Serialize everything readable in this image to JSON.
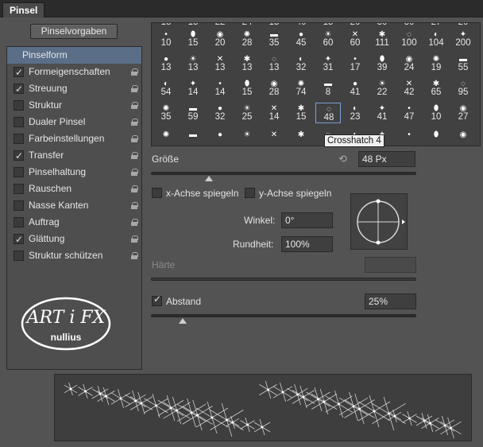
{
  "panel": {
    "tab_label": "Pinsel",
    "preset_button": "Pinselvorgaben"
  },
  "sidebar": {
    "items": [
      {
        "label": "Pinselform",
        "checkbox": false,
        "checked": false,
        "selected": true,
        "lock": false
      },
      {
        "label": "Formeigenschaften",
        "checkbox": true,
        "checked": true,
        "lock": true
      },
      {
        "label": "Streuung",
        "checkbox": true,
        "checked": true,
        "lock": true
      },
      {
        "label": "Struktur",
        "checkbox": true,
        "checked": false,
        "lock": true
      },
      {
        "label": "Dualer Pinsel",
        "checkbox": true,
        "checked": false,
        "lock": true
      },
      {
        "label": "Farbeinstellungen",
        "checkbox": true,
        "checked": false,
        "lock": true
      },
      {
        "label": "Transfer",
        "checkbox": true,
        "checked": true,
        "lock": true
      },
      {
        "label": "Pinselhaltung",
        "checkbox": true,
        "checked": false,
        "lock": true
      },
      {
        "label": "Rauschen",
        "checkbox": true,
        "checked": false,
        "lock": true
      },
      {
        "label": "Nasse Kanten",
        "checkbox": true,
        "checked": false,
        "lock": true
      },
      {
        "label": "Auftrag",
        "checkbox": true,
        "checked": false,
        "lock": true
      },
      {
        "label": "Glättung",
        "checkbox": true,
        "checked": true,
        "lock": true
      },
      {
        "label": "Struktur schützen",
        "checkbox": true,
        "checked": false,
        "lock": true
      }
    ],
    "logo": {
      "text_main": "ART i FX",
      "text_sub": "nullius"
    }
  },
  "brush_grid": {
    "top_row": [
      "10",
      "15",
      "20",
      "28",
      "35",
      "45",
      "60",
      "60",
      "111",
      "100",
      "104",
      "200"
    ],
    "rows": [
      [
        "13",
        "13",
        "13",
        "13",
        "13",
        "32",
        "31",
        "17",
        "39",
        "24",
        "19",
        "55"
      ],
      [
        "54",
        "14",
        "14",
        "15",
        "28",
        "74",
        "8",
        "41",
        "22",
        "42",
        "65",
        "95"
      ],
      [
        "35",
        "59",
        "32",
        "25",
        "14",
        "15",
        "48",
        "23",
        "41",
        "47",
        "10",
        "27"
      ],
      [
        "",
        "",
        "",
        "",
        "",
        "",
        "",
        "",
        "",
        "",
        "",
        ""
      ]
    ],
    "partial_top": [
      "18",
      "18",
      "22",
      "24",
      "15",
      "40",
      "15",
      "20",
      "30",
      "30",
      "27",
      "20"
    ],
    "row3_extra": [
      "18",
      "30"
    ],
    "row4_last": "26",
    "selected_value": "48",
    "tooltip": "Crosshatch 4"
  },
  "controls": {
    "size_label": "Größe",
    "size_value": "48 Px",
    "size_slider_fraction": 0.22,
    "flip_x_label": "x-Achse spiegeln",
    "flip_y_label": "y-Achse spiegeln",
    "angle_label": "Winkel:",
    "angle_value": "0°",
    "roundness_label": "Rundheit:",
    "roundness_value": "100%",
    "hardness_label": "Härte",
    "spacing_label": "Abstand",
    "spacing_checked": true,
    "spacing_value": "25%",
    "spacing_slider_fraction": 0.12
  },
  "colors": {
    "selection": "#5a6e88",
    "panel": "#535353"
  }
}
